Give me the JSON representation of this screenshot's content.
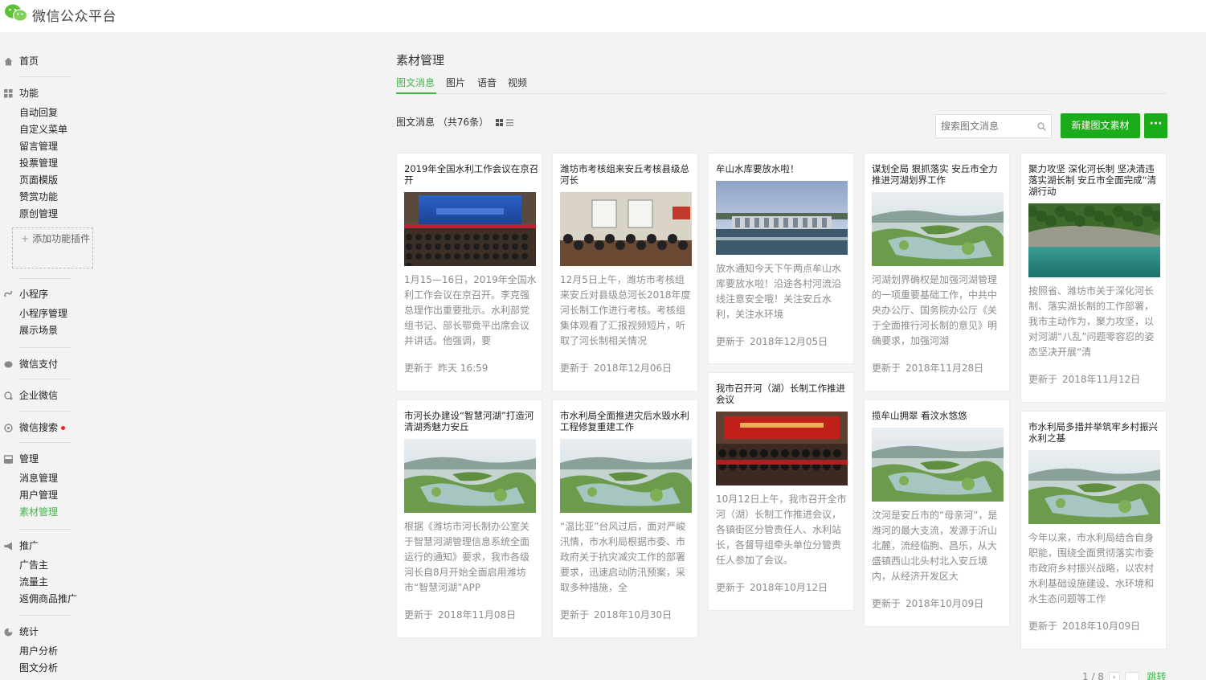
{
  "app": {
    "title": "微信公众平台"
  },
  "sidebar": {
    "home": "首页",
    "function": {
      "label": "功能",
      "items": [
        "自动回复",
        "自定义菜单",
        "留言管理",
        "投票管理",
        "页面模版",
        "赞赏功能",
        "原创管理"
      ],
      "add_plugin": "添加功能插件"
    },
    "miniprogram": {
      "label": "小程序",
      "items": [
        "小程序管理",
        "展示场景"
      ]
    },
    "wechat_pay": "微信支付",
    "enterprise_wechat": "企业微信",
    "wechat_search": "微信搜索",
    "manage": {
      "label": "管理",
      "items": [
        "消息管理",
        "用户管理",
        "素材管理"
      ],
      "active": "素材管理"
    },
    "promote": {
      "label": "推广",
      "items": [
        "广告主",
        "流量主",
        "返佣商品推广"
      ]
    },
    "stats": {
      "label": "统计",
      "items": [
        "用户分析",
        "图文分析"
      ]
    }
  },
  "main": {
    "page_title": "素材管理",
    "tabs": [
      {
        "label": "图文消息",
        "active": true
      },
      {
        "label": "图片",
        "active": false
      },
      {
        "label": "语音",
        "active": false
      },
      {
        "label": "视频",
        "active": false
      }
    ],
    "count_label": "图文消息 （共76条）",
    "search_placeholder": "搜索图文消息",
    "new_button": "新建图文素材",
    "more_button": "···",
    "updated_prefix": "更新于",
    "pagination": {
      "page": "1 / 8",
      "jump_label": "跳转"
    }
  },
  "cards": [
    {
      "title": "2019年全国水利工作会议在京召开",
      "image": "meeting-hall",
      "desc": "1月15—16日，2019年全国水利工作会议在京召开。李克强总理作出重要批示。水利部党组书记、部长鄂竟平出席会议并讲话。他强调，要",
      "time": "昨天 16:59"
    },
    {
      "title": "潍坊市考核组来安丘考核县级总河长",
      "image": "conference-room",
      "desc": "12月5日上午，潍坊市考核组来安丘对县级总河长2018年度河长制工作进行考核。考核组集体观看了汇报视频短片，听取了河长制相关情况",
      "time": "2018年12月06日"
    },
    {
      "title": "牟山水库要放水啦！",
      "image": "reservoir-dam",
      "desc": "放水通知今天下午两点牟山水库要放水啦！沿途各村河流沿线注意安全哦！关注安丘水利，关注水环境",
      "time": "2018年12月05日"
    },
    {
      "title": "谋划全局 狠抓落实 安丘市全力推进河湖划界工作",
      "image": "lake-aerial",
      "desc": "河湖划界确权是加强河湖管理的一项重要基础工作，中共中央办公厅、国务院办公厅《关于全面推行河长制的意见》明确要求，加强河湖",
      "time": "2018年11月28日"
    },
    {
      "title": "聚力攻坚 深化河长制 坚决清违 落实湖长制 安丘市全面完成“清湖行动",
      "image": "green-lake",
      "desc": "按照省、潍坊市关于深化河长制、落实湖长制的工作部署，我市主动作为，聚力攻坚，以对河湖“八乱”问题零容忍的姿态坚决开展“清",
      "time": "2018年11月12日"
    },
    {
      "title": "市河长办建设“智慧河湖”打造河清湖秀魅力安丘",
      "image": "lake-aerial",
      "desc": "根据《潍坊市河长制办公室关于智慧河湖管理信息系统全面运行的通知》要求，我市各级河长自8月开始全面启用潍坊市“智慧河湖”APP",
      "time": "2018年11月08日"
    },
    {
      "title": "市水利局全面推进灾后水毁水利工程修复重建工作",
      "image": "lake-aerial",
      "desc": "“温比亚”台风过后，面对严峻汛情，市水利局根据市委、市政府关于抗灾减灾工作的部署要求，迅速启动防汛预案，采取多种措施，全",
      "time": "2018年10月30日"
    },
    {
      "title": "我市召开河（湖）长制工作推进会议",
      "image": "red-meeting",
      "desc": "10月12日上午，我市召开全市河（湖）长制工作推进会议，各镇街区分管责任人、水利站长，各督导组牵头单位分管责任人参加了会议。",
      "time": "2018年10月12日"
    },
    {
      "title": "揽牟山拥翠 看汶水悠悠",
      "image": "lake-aerial",
      "desc": "汶河是安丘市的“母亲河”，是潍河的最大支流，发源于沂山北麓，流经临朐、昌乐，从大盛镇西山北头村北入安丘境内，从经济开发区大",
      "time": "2018年10月09日"
    },
    {
      "title": "市水利局多措并举筑牢乡村振兴水利之基",
      "image": "lake-aerial",
      "desc": "今年以来，市水利局结合自身职能，围绕全面贯彻落实市委市政府乡村振兴战略，以农村水利基础设施建设、水环境和水生态问题等工作",
      "time": "2018年10月09日"
    }
  ],
  "colors": {
    "accent": "#44b549",
    "button": "#1aad19",
    "text_muted": "#8c8c8c",
    "alert_dot": "#e22222"
  }
}
